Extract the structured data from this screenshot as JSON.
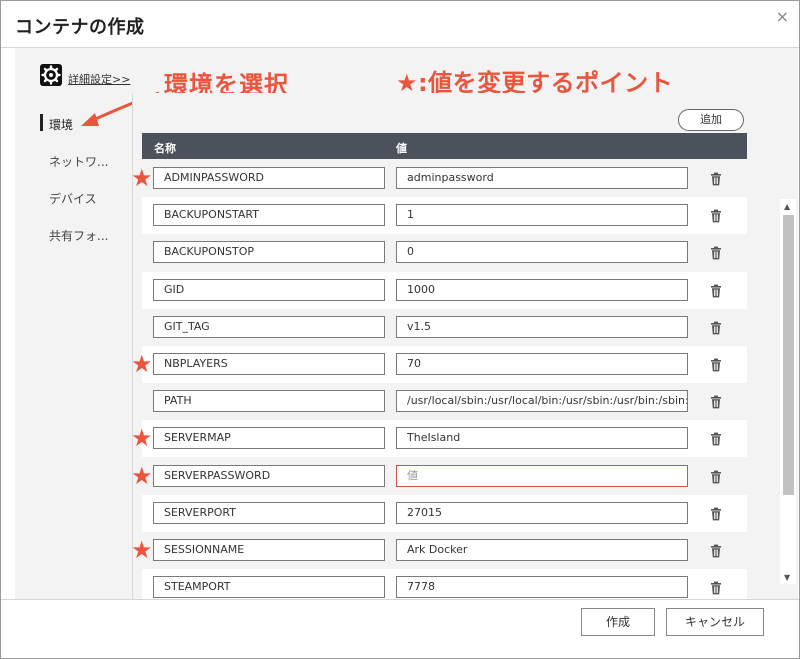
{
  "window": {
    "title": "コンテナの作成",
    "close_label": "×"
  },
  "advanced_settings": {
    "label": "詳細設定>>",
    "icon": "gear-icon"
  },
  "annotations": {
    "select_env": "環境を選択",
    "star_note": "★:値を変更するポイント",
    "color": "#e9553d"
  },
  "sidebar": {
    "items": [
      {
        "label": "環境",
        "active": true
      },
      {
        "label": "ネットワ..."
      },
      {
        "label": "デバイス"
      },
      {
        "label": "共有フォ..."
      }
    ]
  },
  "table": {
    "add_label": "追加",
    "columns": {
      "name": "名称",
      "value": "値"
    },
    "rows": [
      {
        "name": "ADMINPASSWORD",
        "value": "adminpassword",
        "starred": true
      },
      {
        "name": "BACKUPONSTART",
        "value": "1"
      },
      {
        "name": "BACKUPONSTOP",
        "value": "0"
      },
      {
        "name": "GID",
        "value": "1000"
      },
      {
        "name": "GIT_TAG",
        "value": "v1.5"
      },
      {
        "name": "NBPLAYERS",
        "value": "70",
        "starred": true
      },
      {
        "name": "PATH",
        "value": "/usr/local/sbin:/usr/local/bin:/usr/sbin:/usr/bin:/sbin:/bi"
      },
      {
        "name": "SERVERMAP",
        "value": "TheIsland",
        "starred": true
      },
      {
        "name": "SERVERPASSWORD",
        "value": "",
        "placeholder": "値",
        "starred": true,
        "invalid": true
      },
      {
        "name": "SERVERPORT",
        "value": "27015"
      },
      {
        "name": "SESSIONNAME",
        "value": "Ark Docker",
        "starred": true
      },
      {
        "name": "STEAMPORT",
        "value": "7778"
      }
    ]
  },
  "footer": {
    "create_label": "作成",
    "cancel_label": "キャンセル"
  },
  "colors": {
    "table_header": "#4b525c",
    "annotation": "#e9553d",
    "invalid_border": "#d0534a"
  }
}
